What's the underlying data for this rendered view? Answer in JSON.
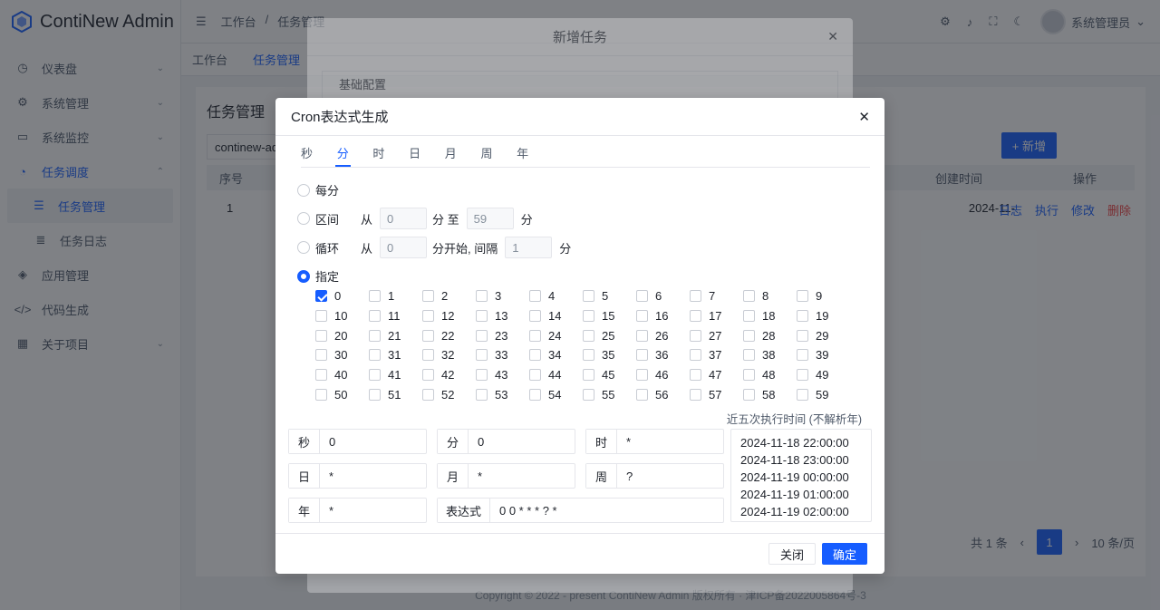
{
  "app": {
    "name": "ContiNew Admin",
    "menu": [
      {
        "label": "仪表盘",
        "icon": "dashboard-icon"
      },
      {
        "label": "系统管理",
        "icon": "gear-icon"
      },
      {
        "label": "系统监控",
        "icon": "monitor-icon"
      },
      {
        "label": "任务调度",
        "icon": "clock-icon"
      },
      {
        "label": "任务管理",
        "icon": "list-icon"
      },
      {
        "label": "任务日志",
        "icon": "log-icon"
      },
      {
        "label": "应用管理",
        "icon": "cube-icon"
      },
      {
        "label": "代码生成",
        "icon": "code-icon"
      },
      {
        "label": "关于项目",
        "icon": "grid-icon"
      }
    ],
    "breadcrumb": [
      "工作台",
      "/",
      "任务管理"
    ],
    "user": "系统管理员",
    "tabs": [
      "工作台",
      "任务管理"
    ],
    "page_title": "任务管理",
    "search_value": "continew-ad",
    "table_headers": [
      "序号",
      "创建时间",
      "操作"
    ],
    "row": {
      "index": "1",
      "created": "2024-11-",
      "actions": [
        "日志",
        "执行",
        "修改",
        "删除"
      ]
    },
    "add_label": "新增",
    "pagination": {
      "total": "共 1 条",
      "page": "1",
      "size": "10 条/页"
    },
    "footer": "Copyright © 2022 - present ContiNew Admin 版权所有 · 津ICP备2022005864号-3"
  },
  "outer_modal": {
    "title": "新增任务",
    "section": "基础配置"
  },
  "dialog": {
    "title": "Cron表达式生成",
    "tabs": [
      "秒",
      "分",
      "时",
      "日",
      "月",
      "周",
      "年"
    ],
    "opt_every": "每分",
    "opt_range": "区间",
    "opt_loop": "循环",
    "opt_specify": "指定",
    "from": "从",
    "range_from": "0",
    "range_mid": "分 至",
    "range_to": "59",
    "unit": "分",
    "loop_from": "0",
    "loop_mid": "分开始, 间隔",
    "loop_step": "1",
    "next_title": "近五次执行时间 (不解析年)",
    "next_times": [
      "2024-11-18 22:00:00",
      "2024-11-18 23:00:00",
      "2024-11-19 00:00:00",
      "2024-11-19 01:00:00",
      "2024-11-19 02:00:00"
    ],
    "fields": {
      "sec_label": "秒",
      "sec": "0",
      "min_label": "分",
      "min": "0",
      "hour_label": "时",
      "hour": "*",
      "day_label": "日",
      "day": "*",
      "month_label": "月",
      "month": "*",
      "week_label": "周",
      "week": "?",
      "year_label": "年",
      "year": "*",
      "expr_label": "表达式",
      "expr": "0 0 * * * ? *"
    },
    "close_btn": "关闭",
    "ok_btn": "确定"
  }
}
